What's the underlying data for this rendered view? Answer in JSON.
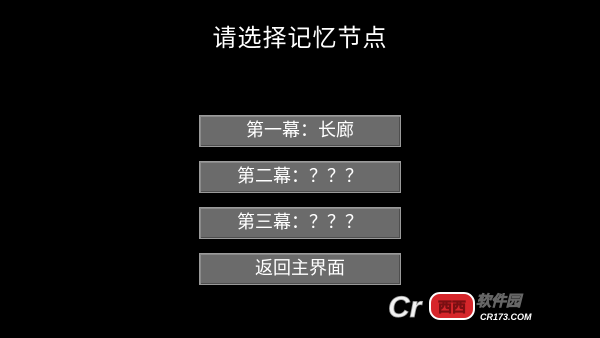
{
  "screen": {
    "title": "请选择记忆节点"
  },
  "menu": {
    "items": [
      {
        "label": "第一幕：长廊"
      },
      {
        "label": "第二幕：？？？"
      },
      {
        "label": "第三幕：？？？"
      },
      {
        "label": "返回主界面"
      }
    ]
  },
  "watermark": {
    "brand": "西西软件园",
    "url": "CR173.COM"
  },
  "colors": {
    "background": "#000000",
    "button": "#6b6b6b",
    "button_border": "#9a9a9a",
    "text": "#ffffff",
    "watermark_red": "#d6262b"
  }
}
